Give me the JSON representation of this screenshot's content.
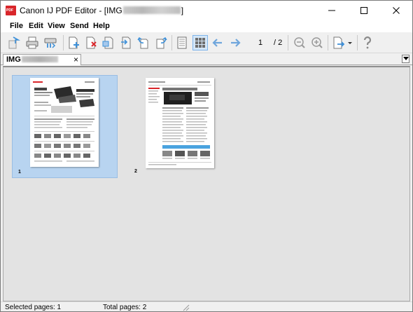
{
  "window": {
    "title_prefix": "Canon IJ PDF Editor - [IMG",
    "title_suffix": "]",
    "minimize_glyph": "—",
    "maximize_glyph": "☐",
    "close_glyph": "✕"
  },
  "menu": {
    "items": [
      "File",
      "Edit",
      "View",
      "Send",
      "Help"
    ]
  },
  "toolbar": {
    "icons": [
      "open-document-icon",
      "print-icon",
      "scan-icon",
      "add-page-icon",
      "delete-page-icon",
      "extract-page-icon",
      "insert-page-icon",
      "rotate-left-icon",
      "rotate-right-icon",
      "single-page-view-icon",
      "thumbnail-view-icon",
      "previous-page-icon",
      "next-page-icon",
      "zoom-out-icon",
      "zoom-in-icon",
      "export-icon",
      "help-icon"
    ],
    "current_page": "1",
    "total_pages": "/ 2"
  },
  "tab": {
    "label_prefix": "IMG",
    "close_glyph": "×",
    "dropdown_glyph": "▾"
  },
  "pages": [
    {
      "label": "1",
      "selected": true
    },
    {
      "label": "2",
      "selected": false
    }
  ],
  "status": {
    "selected_pages": "Selected pages: 1",
    "total_pages": "Total pages: 2"
  },
  "colors": {
    "selection": "#b8d4f0",
    "accent_blue": "#3c8fd8",
    "brand_red": "#d9262b"
  }
}
